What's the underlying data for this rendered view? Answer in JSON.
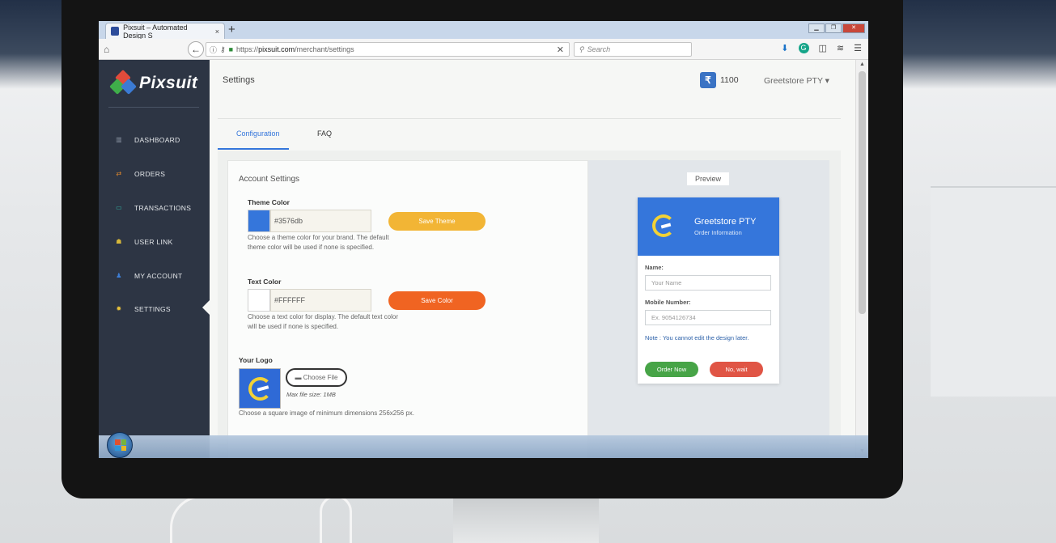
{
  "browser": {
    "tab_title": "Pixsuit – Automated Design S",
    "tab_close": "×",
    "new_tab": "+",
    "url_prefix": "https://",
    "url_domain": "pixsuit.com",
    "url_path": "/merchant/settings",
    "search_placeholder": "Search"
  },
  "sidebar": {
    "brand": "Pixsuit",
    "items": [
      {
        "label": "DASHBOARD",
        "icon": "bar-chart-icon"
      },
      {
        "label": "ORDERS",
        "icon": "swap-arrows-icon"
      },
      {
        "label": "TRANSACTIONS",
        "icon": "credit-card-icon"
      },
      {
        "label": "USER LINK",
        "icon": "users-icon"
      },
      {
        "label": "MY ACCOUNT",
        "icon": "user-icon"
      },
      {
        "label": "SETTINGS",
        "icon": "gear-icon"
      }
    ],
    "active": "SETTINGS"
  },
  "header": {
    "title": "Settings",
    "wallet_symbol": "₹",
    "balance": "1100",
    "account_name": "Greetstore PTY ▾"
  },
  "tabs": [
    "Configuration",
    "FAQ"
  ],
  "account_settings": {
    "title": "Account Settings",
    "theme_color": {
      "label": "Theme Color",
      "value": "#3576db",
      "button": "Save Theme",
      "help": "Choose a theme color for your brand. The default theme color will be used if none is specified."
    },
    "text_color": {
      "label": "Text Color",
      "value": "#FFFFFF",
      "button": "Save Color",
      "help": "Choose a text color for display. The default text color will be used if none is specified."
    },
    "logo": {
      "label": "Your Logo",
      "button": "Choose File",
      "max_size": "Max file size: 1MB",
      "help": "Choose a square image of minimum dimensions 256x256 px."
    }
  },
  "preview": {
    "label": "Preview",
    "store_name": "Greetstore PTY",
    "subtitle": "Order Information",
    "name_label": "Name:",
    "name_placeholder": "Your Name",
    "mobile_label": "Mobile Number:",
    "mobile_placeholder": "Ex. 9054126734",
    "note": "Note : You cannot edit the design later.",
    "order_button": "Order Now",
    "cancel_button": "No, wait"
  },
  "colors": {
    "sidebar": "#2d3544",
    "theme": "#3576db",
    "save_theme": "#f2b535",
    "save_color": "#f06422",
    "order_now": "#47a447",
    "no_wait": "#e05545"
  }
}
